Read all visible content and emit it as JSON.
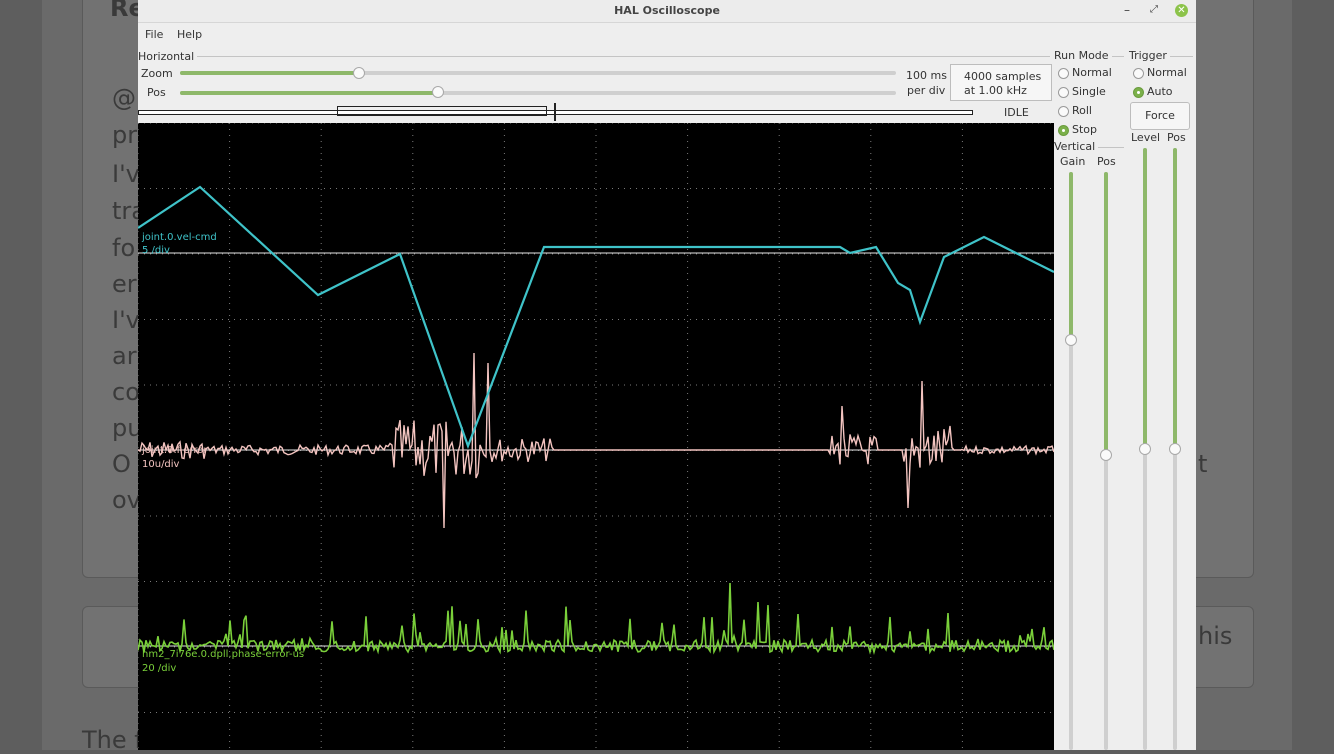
{
  "window": {
    "title": "HAL Oscilloscope"
  },
  "menu": {
    "file": "File",
    "help": "Help"
  },
  "horizontal": {
    "label": "Horizontal",
    "zoom_label": "Zoom",
    "pos_label": "Pos",
    "zoom_value": 0.25,
    "pos_value": 0.36,
    "scale_line1": "100 ms",
    "scale_line2": "per div",
    "samples_line1": "4000 samples",
    "samples_line2": "at 1.00 kHz",
    "status": "IDLE"
  },
  "run_mode": {
    "label": "Run Mode",
    "options": [
      "Normal",
      "Single",
      "Roll",
      "Stop"
    ],
    "selected": "Stop"
  },
  "trigger": {
    "label": "Trigger",
    "options": [
      "Normal",
      "Auto"
    ],
    "selected": "Auto",
    "force_label": "Force",
    "level_label": "Level",
    "pos_label": "Pos",
    "level_value": 0.5,
    "pos_value": 0.5
  },
  "vertical": {
    "label": "Vertical",
    "gain_label": "Gain",
    "pos_label": "Pos",
    "gain_value": 0.71,
    "pos_value": 0.51
  },
  "channels": [
    {
      "name": "joint.0.vel-cmd",
      "scale": "5 /div",
      "color": "#3fc3c9"
    },
    {
      "name": "joint.0.f-error",
      "scale": "10u/div",
      "color": "#f3c4c0"
    },
    {
      "name": "hm2_7i76e.0.dpll.phase-error-us",
      "scale": "20 /div",
      "color": "#7ad03a"
    }
  ],
  "background_page": {
    "text_fragments": [
      "@",
      "pr",
      "I'v",
      "tra",
      "fo",
      "er",
      "I'v",
      "ar",
      "co",
      "pu",
      "O",
      "ov",
      "t",
      "his",
      "The f",
      "Re"
    ]
  }
}
